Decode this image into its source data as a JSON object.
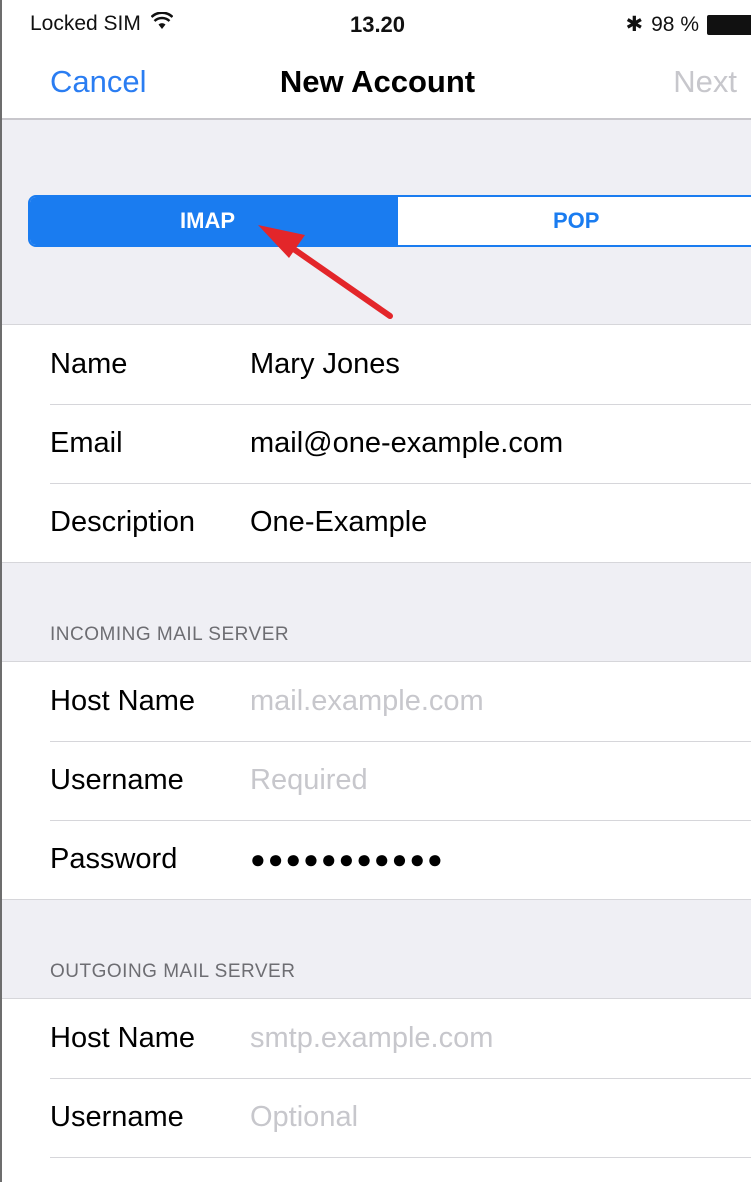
{
  "status_bar": {
    "carrier": "Locked SIM",
    "time": "13.20",
    "bluetooth": "✱",
    "battery_percent": "98 %",
    "icons": [
      "wifi-icon",
      "bluetooth-icon",
      "battery-icon"
    ]
  },
  "nav": {
    "cancel_label": "Cancel",
    "title": "New Account",
    "next_label": "Next"
  },
  "segmented_control": {
    "options": [
      "IMAP",
      "POP"
    ],
    "selected": "IMAP",
    "selected_color": "#1a7cf0"
  },
  "account": {
    "rows": [
      {
        "label": "Name",
        "value": "Mary Jones"
      },
      {
        "label": "Email",
        "value": "mail@one-example.com"
      },
      {
        "label": "Description",
        "value": "One-Example"
      }
    ]
  },
  "incoming": {
    "header": "INCOMING MAIL SERVER",
    "host_label": "Host Name",
    "host_placeholder": "mail.example.com",
    "username_label": "Username",
    "username_placeholder": "Required",
    "password_label": "Password",
    "password_value": "●●●●●●●●●●●"
  },
  "outgoing": {
    "header": "OUTGOING MAIL SERVER",
    "host_label": "Host Name",
    "host_placeholder": "smtp.example.com",
    "username_label": "Username",
    "username_placeholder": "Optional"
  },
  "colors": {
    "accent": "#2a7df2",
    "annotation_arrow": "#e3262a",
    "grouped_background": "#efeff4"
  }
}
